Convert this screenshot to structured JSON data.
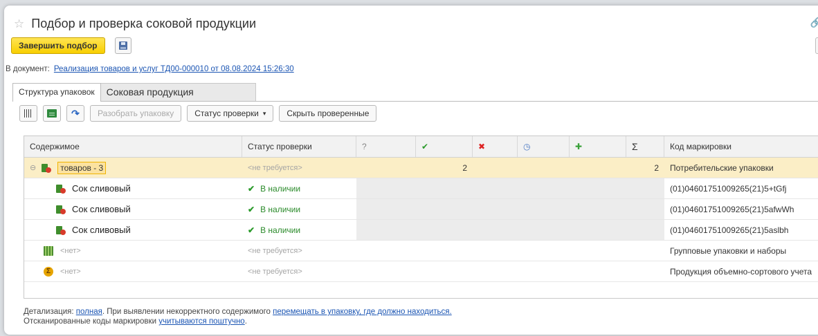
{
  "window": {
    "title": "Подбор и проверка соковой продукции"
  },
  "toolbar": {
    "finish_label": "Завершить подбор"
  },
  "document": {
    "prefix": "В документ:",
    "link": "Реализация товаров и услуг ТД00-000010 от 08.08.2024 15:26:30"
  },
  "tabs": [
    {
      "label": "Структура упаковок",
      "active": true
    },
    {
      "label": "Соковая продукция",
      "active": false
    }
  ],
  "actions": {
    "unpack_label": "Разобрать упаковку",
    "status_label": "Статус проверки",
    "hide_checked_label": "Скрыть проверенные"
  },
  "table": {
    "headers": {
      "content": "Содержимое",
      "status": "Статус проверки",
      "unknown": "?",
      "checked": "✔",
      "rejected": "✖",
      "pending": "◷",
      "added": "✚",
      "total": "Σ",
      "code": "Код маркировки"
    },
    "group": {
      "label": "товаров - 3",
      "status": "<не требуется>",
      "checked_count": "2",
      "total_count": "2",
      "code": "Потребительские упаковки"
    },
    "items": [
      {
        "name": "Сок сливовый",
        "status": "В наличии",
        "code": "(01)04601751009265(21)5+tGfj"
      },
      {
        "name": "Сок сливовый",
        "status": "В наличии",
        "code": "(01)04601751009265(21)5afwWh"
      },
      {
        "name": "Сок сливовый",
        "status": "В наличии",
        "code": "(01)04601751009265(21)5aslbh"
      }
    ],
    "group_packages": {
      "label": "<нет>",
      "status": "<не требуется>",
      "code": "Групповые упаковки и наборы"
    },
    "bulk": {
      "label": "<нет>",
      "status": "<не требуется>",
      "code": "Продукция объемно-сортового учета"
    }
  },
  "footer": {
    "detail_prefix": "Детализация:",
    "detail_link": "полная",
    "detail_mid": ". При выявлении некорректного содержимого",
    "detail_action": "перемещать в упаковку, где должно находиться.",
    "scan_prefix": "Отсканированные коды маркировки",
    "scan_link": "учитываются поштучно",
    "scan_suffix": "."
  },
  "colors": {
    "accent_yellow": "#f8cf00",
    "selected_row": "#fbeec6",
    "link": "#1b55b3",
    "ok_green": "#2a8a2a"
  }
}
